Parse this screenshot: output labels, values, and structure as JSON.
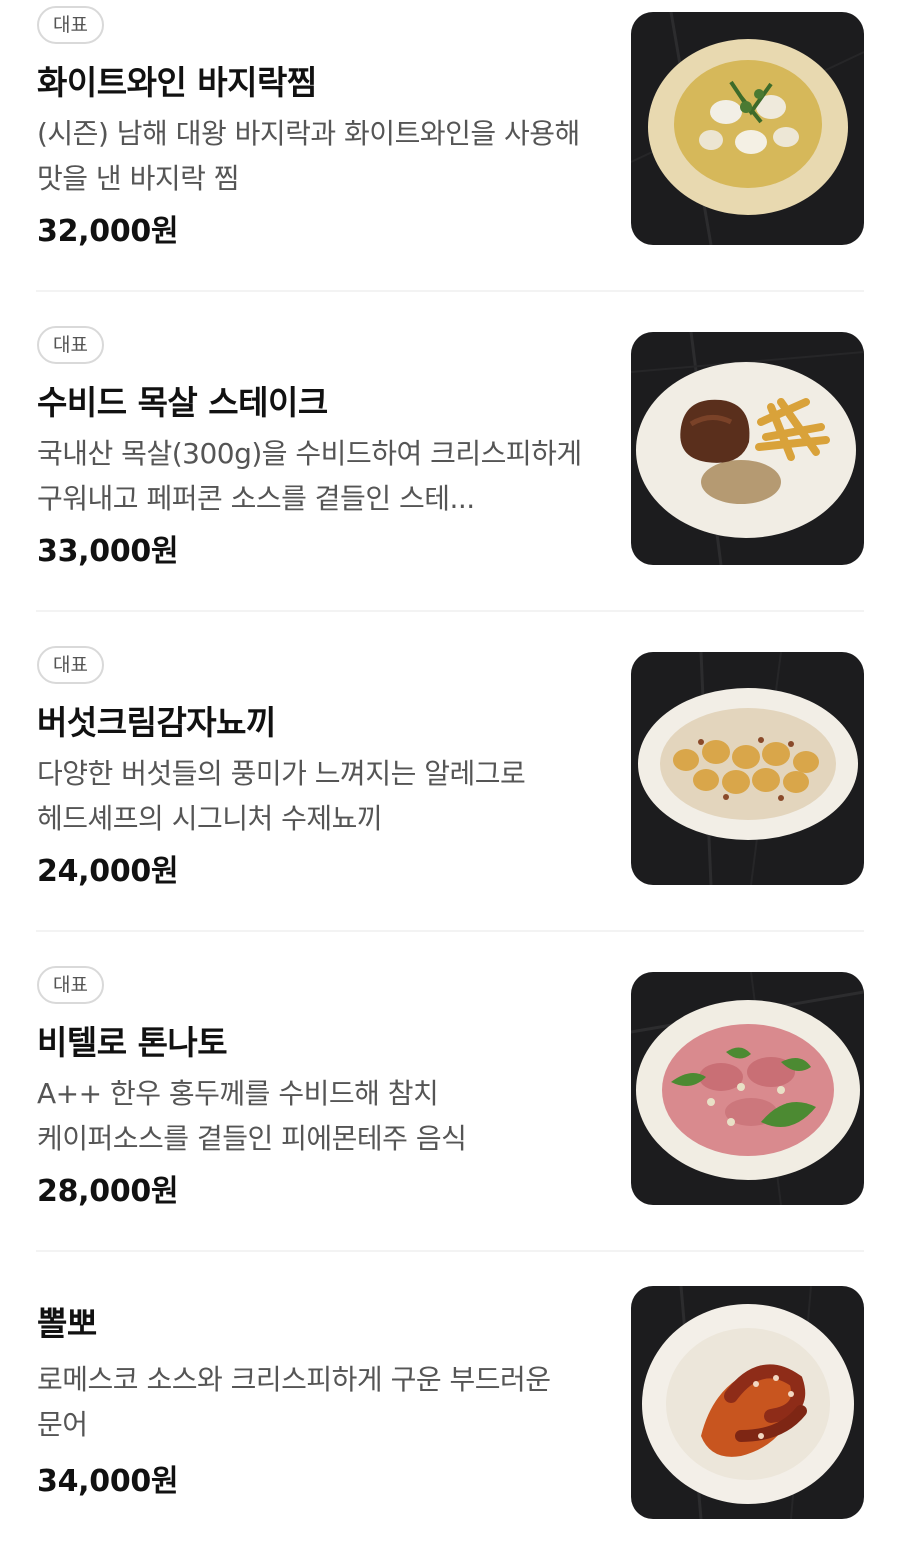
{
  "menu": {
    "items": [
      {
        "badge": "대표",
        "name": "화이트와인 바지락찜",
        "description": "(시즌) 남해 대왕 바지락과 화이트와인을 사용해 맛을 낸 바지락 찜",
        "price": "32,000원"
      },
      {
        "badge": "대표",
        "name": "수비드 목살 스테이크",
        "description": "국내산 목살(300g)을 수비드하여 크리스피하게 구워내고 페퍼콘 소스를 곁들인 스테...",
        "price": "33,000원"
      },
      {
        "badge": "대표",
        "name": "버섯크림감자뇨끼",
        "description": "다양한 버섯들의 풍미가 느껴지는 알레그로 헤드셰프의 시그니처 수제뇨끼",
        "price": "24,000원"
      },
      {
        "badge": "대표",
        "name": "비텔로 톤나토",
        "description": "A++ 한우 홍두께를 수비드해 참치 케이퍼소스를 곁들인 피에몬테주 음식",
        "price": "28,000원"
      },
      {
        "name": "뽈뽀",
        "description": "로메스코 소스와 크리스피하게 구운 부드러운 문어",
        "price": "34,000원"
      }
    ]
  }
}
